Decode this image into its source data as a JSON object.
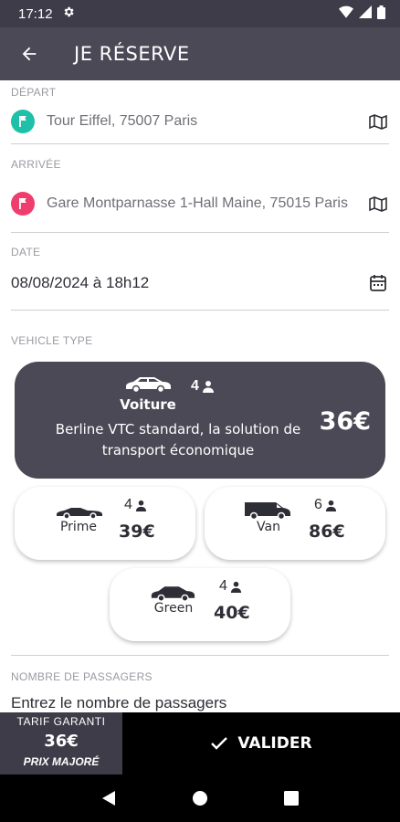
{
  "status_bar": {
    "time": "17:12",
    "icons": [
      "gear-icon",
      "wifi-icon",
      "signal-icon",
      "battery-icon"
    ]
  },
  "app_bar": {
    "title": "JE RÉSERVE",
    "back_icon": "arrow-left-icon"
  },
  "departure": {
    "label": "DÉPART",
    "value": "Tour Eiffel, 75007 Paris",
    "icon": "flag-pin-icon",
    "color": "#1ec0a7"
  },
  "arrival": {
    "label": "ARRIVÉE",
    "value": "Gare Montparnasse 1-Hall Maine, 75015 Paris",
    "icon": "flag-pin-icon",
    "color": "#ef3d6e"
  },
  "date": {
    "label": "DATE",
    "value": "08/08/2024 à 18h12",
    "icon": "calendar-icon"
  },
  "vehicle_type": {
    "label": "VEHICLE TYPE",
    "selected": {
      "name": "Voiture",
      "passengers": "4",
      "description": "Berline VTC standard, la solution de transport économique",
      "price": "36€"
    },
    "options": [
      {
        "name": "Prime",
        "passengers": "4",
        "price": "39€"
      },
      {
        "name": "Van",
        "passengers": "6",
        "price": "86€"
      },
      {
        "name": "Green",
        "passengers": "4",
        "price": "40€"
      }
    ]
  },
  "passengers": {
    "label": "NOMBRE DE PASSAGERS",
    "placeholder": "Entrez le nombre de passagers"
  },
  "bottom_bar": {
    "tarif_label": "TARIF GARANTI",
    "tarif_price": "36€",
    "tarif_note": "PRIX MAJORÉ",
    "validate_label": "VALIDER"
  },
  "colors": {
    "dark": "#4a4955",
    "header": "#4b4956",
    "accent_green": "#1ec0a7",
    "accent_red": "#ef3d6e"
  }
}
